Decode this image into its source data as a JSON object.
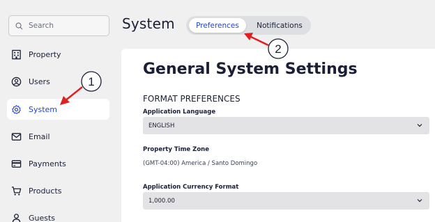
{
  "search": {
    "placeholder": "Search"
  },
  "sidebar": {
    "items": [
      {
        "label": "Property",
        "icon": "building-icon",
        "active": false
      },
      {
        "label": "Users",
        "icon": "user-circle-icon",
        "active": false
      },
      {
        "label": "System",
        "icon": "gear-icon",
        "active": true
      },
      {
        "label": "Email",
        "icon": "envelope-icon",
        "active": false
      },
      {
        "label": "Payments",
        "icon": "credit-card-icon",
        "active": false
      },
      {
        "label": "Products",
        "icon": "cart-icon",
        "active": false
      },
      {
        "label": "Guests",
        "icon": "person-icon",
        "active": false
      }
    ]
  },
  "header": {
    "title": "System",
    "tabs": [
      {
        "label": "Preferences",
        "active": true
      },
      {
        "label": "Notifications",
        "active": false
      }
    ]
  },
  "main": {
    "heading": "General System Settings",
    "section_title": "FORMAT PREFERENCES",
    "fields": {
      "language": {
        "label": "Application Language",
        "value": "ENGLISH"
      },
      "timezone": {
        "label": "Property Time Zone",
        "value": "(GMT-04:00) America / Santo Domingo"
      },
      "currency": {
        "label": "Application Currency Format",
        "value": "1,000.00"
      }
    }
  },
  "annotations": [
    {
      "number": "1",
      "color": "#e02020"
    },
    {
      "number": "2",
      "color": "#e02020"
    }
  ],
  "colors": {
    "accent": "#2447c8",
    "annotation": "#e02020",
    "sidebar_bg": "#f0f0f1"
  }
}
